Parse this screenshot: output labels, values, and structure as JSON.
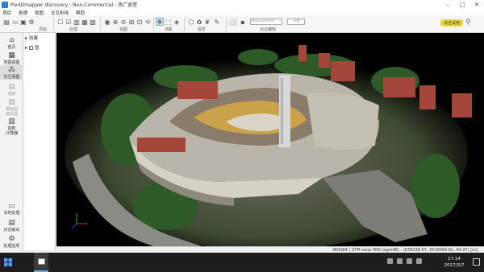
{
  "window": {
    "title": "Pix4Dmapper discovery - Non-Commercial - 南广食堂"
  },
  "menu": [
    "项目",
    "处理",
    "视图",
    "交互析线",
    "帮助"
  ],
  "toolbar": {
    "groups": [
      "项目",
      "处理",
      "视图",
      "测距",
      "视觉",
      "点云编辑"
    ],
    "group_field": "NonLassified",
    "group_button": "分配",
    "trial_button": "点击试用"
  },
  "sidebar": {
    "items": [
      {
        "icon": "home-icon",
        "label": "首页",
        "active": false,
        "enabled": true
      },
      {
        "icon": "map-icon",
        "label": "地图视图",
        "active": false,
        "enabled": true
      },
      {
        "icon": "cloud-icon",
        "label": "交互视图",
        "active": true,
        "enabled": true
      },
      {
        "icon": "mosaic-icon",
        "label": "镶嵌",
        "active": false,
        "enabled": false
      },
      {
        "icon": "index-icon",
        "label": "镶嵌图\n编辑器",
        "active": false,
        "enabled": false
      },
      {
        "icon": "calc-icon",
        "label": "指数\n计算器",
        "active": false,
        "enabled": true
      }
    ],
    "bottom": [
      {
        "icon": "processing-icon",
        "label": "本地处理"
      },
      {
        "icon": "log-icon",
        "label": "日志输出"
      },
      {
        "icon": "options-icon",
        "label": "处理选项"
      }
    ]
  },
  "layers": {
    "rows": [
      {
        "label": "创建",
        "expanded": true
      },
      {
        "label": "层",
        "expanded": true
      }
    ]
  },
  "status": {
    "text": "WGS84 / UTM zone 50N (egm96) - (678238.97, 3529564.61, 44.07) [m]"
  },
  "taskbar": {
    "time": "17:14",
    "date": "2017/3/7"
  }
}
